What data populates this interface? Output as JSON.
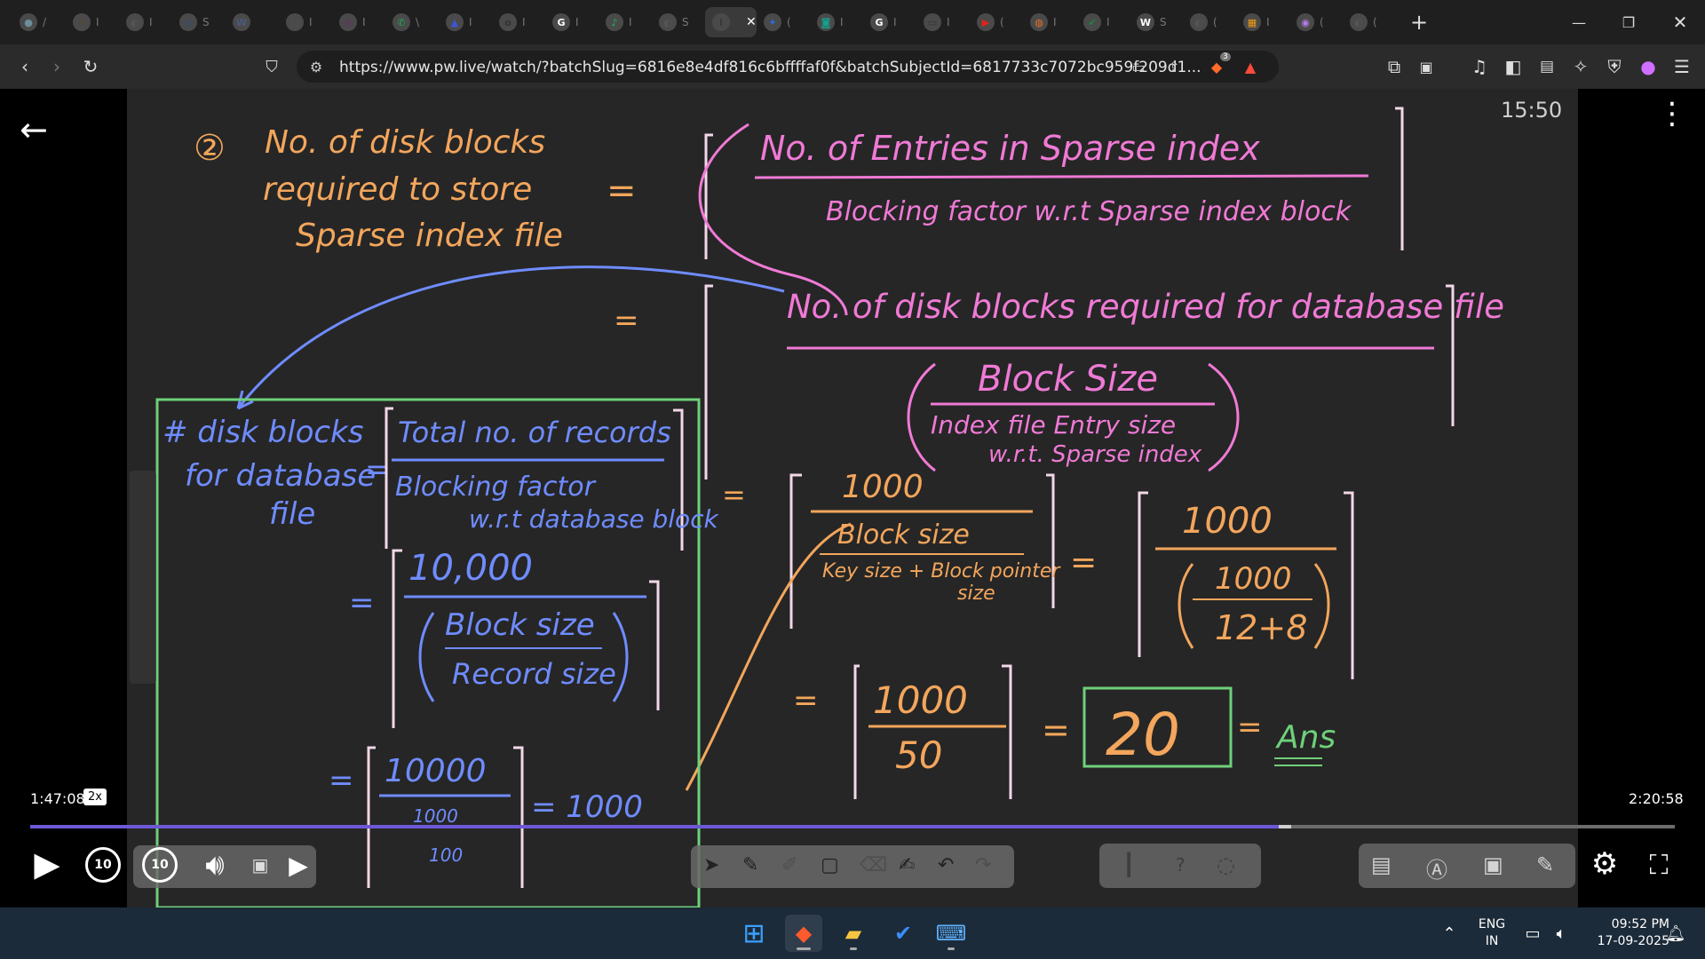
{
  "browser": {
    "tabs": [
      {
        "icon": "●",
        "color": "#6b8f9a",
        "label": "/"
      },
      {
        "icon": "⚡",
        "color": "#5a4a2a",
        "label": "I"
      },
      {
        "icon": "◐",
        "color": "#555",
        "label": "I"
      },
      {
        "icon": "◍",
        "color": "#3c4a6a",
        "label": "S"
      },
      {
        "icon": "W",
        "color": "#4a5a7a",
        "label": ""
      },
      {
        "icon": "◌",
        "color": "#555",
        "label": "I"
      },
      {
        "icon": "◉",
        "color": "#5a3a5a",
        "label": "I"
      },
      {
        "icon": "✆",
        "color": "#1faa55",
        "label": "\\"
      },
      {
        "icon": "▲",
        "color": "#3a56d8",
        "label": "I"
      },
      {
        "icon": "o",
        "color": "#333",
        "label": "I"
      },
      {
        "icon": "G",
        "color": "#fff",
        "label": "I"
      },
      {
        "icon": "♪",
        "color": "#1db954",
        "label": "I"
      },
      {
        "icon": "◐",
        "color": "#555",
        "label": "S"
      },
      {
        "icon": "I",
        "color": "#3a3a3a",
        "label": "",
        "active": true
      },
      {
        "icon": "✦",
        "color": "#2d6be4",
        "label": "("
      },
      {
        "icon": "◙",
        "color": "#14a08a",
        "label": "I"
      },
      {
        "icon": "G",
        "color": "#fff",
        "label": "I"
      },
      {
        "icon": "▭",
        "color": "#333",
        "label": "I"
      },
      {
        "icon": "▶",
        "color": "#e62117",
        "label": "("
      },
      {
        "icon": "◍",
        "color": "#e8702a",
        "label": "I"
      },
      {
        "icon": "✔",
        "color": "#1b8a3a",
        "label": "I"
      },
      {
        "icon": "W",
        "color": "#fff",
        "label": "S"
      },
      {
        "icon": "◐",
        "color": "#555",
        "label": "("
      },
      {
        "icon": "▦",
        "color": "#f39c12",
        "label": "I"
      },
      {
        "icon": "◉",
        "color": "#b57cf0",
        "label": "("
      },
      {
        "icon": "◐",
        "color": "#555",
        "label": "("
      }
    ],
    "new_tab": "+",
    "url": "https://www.pw.live/watch/?batchSlug=6816e8e4df816c6bffffaf0f&batchSubjectId=6817733c7072bc959f209d1...",
    "brave_badge": "3"
  },
  "player": {
    "clock": "15:50",
    "current_time": "1:47:08",
    "speed": "2x",
    "duration": "2:20:58",
    "progress": 0.759,
    "buffered": 0.767,
    "rewind": "10",
    "forward": "10"
  },
  "board": {
    "q_number": "②",
    "q_lines": [
      "No. of disk blocks",
      "required to store",
      "Sparse index file"
    ],
    "eq1": "=",
    "top_num": "No. of Entries in Sparse index",
    "top_den": "Blocking factor w.r.t Sparse index block",
    "eq2": "=",
    "mid_num": "No. of disk blocks required for database file",
    "mid_den_num": "Block Size",
    "mid_den_den_1": "Index file Entry size",
    "mid_den_den_2": "w.r.t. Sparse index",
    "eq3": "=",
    "r1_num": "1000",
    "r1_den_num": "Block size",
    "r1_den_den_1": "Key size + Block pointer",
    "r1_den_den_2": "size",
    "eq4": "=",
    "r2_num": "1000",
    "r2_den_num": "1000",
    "r2_den_den": "12+8",
    "eq5": "=",
    "r3_num": "1000",
    "r3_den": "50",
    "eq6": "=",
    "answer": "20",
    "eq7": "=",
    "ans_label": "Ans",
    "box_lhs_1": "# disk blocks",
    "box_lhs_2": "for database",
    "box_lhs_3": "file",
    "box_eq": "=",
    "box_num": "Total no. of records",
    "box_den_1": "Blocking factor",
    "box_den_2": "w.r.t database block",
    "box_eq2": "=",
    "box2_num": "10,000",
    "box2_den_num": "Block size",
    "box2_den_den": "Record size",
    "box_eq3": "=",
    "box3_num": "10000",
    "box3_den_num": "1000",
    "box3_den_den": "100",
    "box3_result": "= 1000"
  },
  "taskbar": {
    "lang_1": "ENG",
    "lang_2": "IN",
    "time": "09:52 PM",
    "date": "17-09-2025"
  }
}
